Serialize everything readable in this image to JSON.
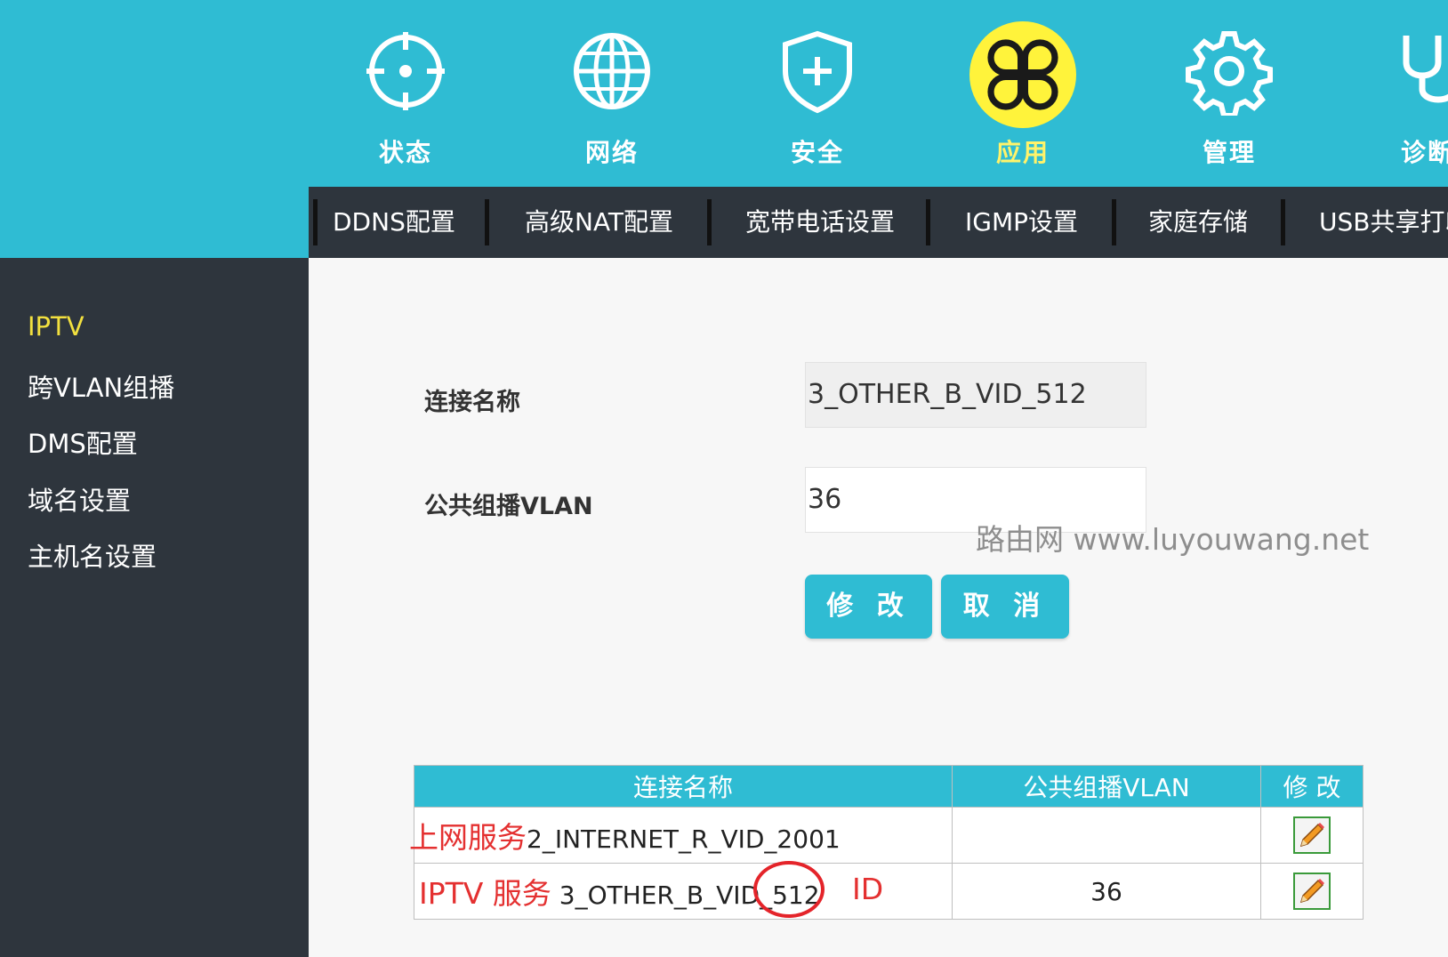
{
  "top_nav": [
    {
      "label": "状态",
      "icon": "status-target-icon"
    },
    {
      "label": "网络",
      "icon": "globe-icon"
    },
    {
      "label": "安全",
      "icon": "shield-plus-icon"
    },
    {
      "label": "应用",
      "icon": "apps-clover-icon",
      "active": true
    },
    {
      "label": "管理",
      "icon": "gear-icon"
    },
    {
      "label": "诊断",
      "icon": "stethoscope-icon"
    }
  ],
  "sub_nav": [
    "DDNS配置",
    "高级NAT配置",
    "宽带电话设置",
    "IGMP设置",
    "家庭存储",
    "USB共享打印"
  ],
  "sidebar": [
    "IPTV",
    "跨VLAN组播",
    "DMS配置",
    "域名设置",
    "主机名设置"
  ],
  "form": {
    "conn_name_label": "连接名称",
    "conn_name_value": "3_OTHER_B_VID_512",
    "vlan_label": "公共组播VLAN",
    "vlan_value": "36"
  },
  "buttons": {
    "modify": "修 改",
    "cancel": "取 消"
  },
  "watermark": "路由网 www.luyouwang.net",
  "table": {
    "headers": [
      "连接名称",
      "公共组播VLAN",
      "修 改"
    ],
    "rows": [
      {
        "annotation": "上网服务",
        "name": "2_INTERNET_R_VID_2001",
        "vlan": ""
      },
      {
        "annotation": "IPTV 服务",
        "name": "3_OTHER_B_VID_512",
        "vlan": "36"
      }
    ]
  },
  "id_annotation": "ID",
  "colors": {
    "teal": "#2fbcd3",
    "dark": "#2e353d",
    "active_yellow": "#fff36a",
    "annotation_red": "#e43030"
  }
}
